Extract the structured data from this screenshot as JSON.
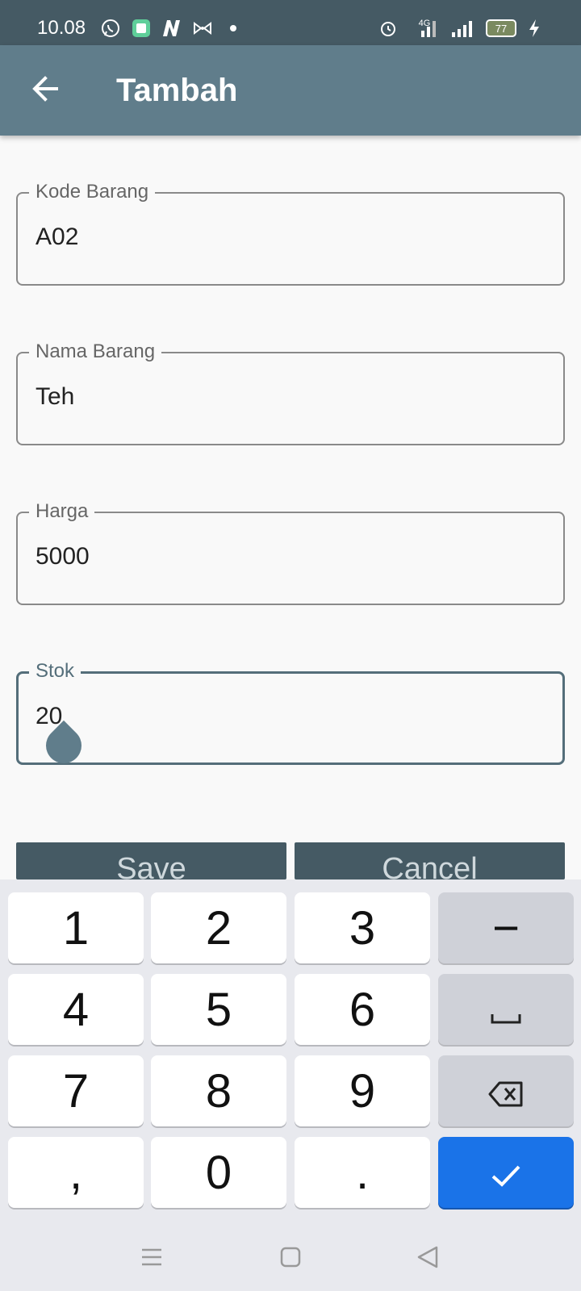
{
  "status_bar": {
    "time": "10.08",
    "network": "4G",
    "battery": "77",
    "left_icons": [
      "whatsapp-icon",
      "app-icon",
      "n-icon",
      "bow-icon",
      "dot-icon"
    ],
    "right_icons": [
      "alarm-icon",
      "4g-signal-icon",
      "signal-icon",
      "battery-icon",
      "charging-icon"
    ]
  },
  "app_bar": {
    "title": "Tambah",
    "back_icon": "arrow-left-icon"
  },
  "form": {
    "fields": [
      {
        "label": "Kode Barang",
        "value": "A02",
        "focused": false
      },
      {
        "label": "Nama Barang",
        "value": "Teh",
        "focused": false
      },
      {
        "label": "Harga",
        "value": "5000",
        "focused": false
      },
      {
        "label": "Stok",
        "value": "20",
        "focused": true
      }
    ],
    "save_label": "Save",
    "cancel_label": "Cancel"
  },
  "keyboard": {
    "rows": [
      [
        "1",
        "2",
        "3",
        "−"
      ],
      [
        "4",
        "5",
        "6",
        "space"
      ],
      [
        "7",
        "8",
        "9",
        "backspace"
      ],
      [
        ",",
        "0",
        ".",
        "done"
      ]
    ]
  },
  "nav_bar": {
    "icons": [
      "menu-icon",
      "home-icon",
      "back-triangle-icon"
    ]
  },
  "colors": {
    "status_bar": "#455a64",
    "app_bar": "#607d8b",
    "button": "#455a64",
    "focus": "#546e7a",
    "keyboard_done": "#1a73e8"
  }
}
